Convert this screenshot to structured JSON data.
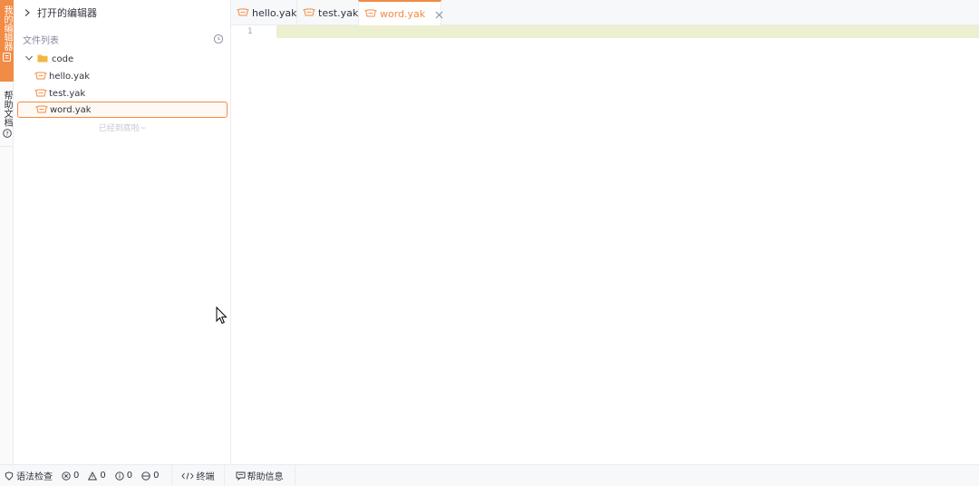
{
  "activity": {
    "active_label": "我的编辑器",
    "help_label": "帮助文档"
  },
  "panel": {
    "header_title": "打开的编辑器",
    "list_title": "文件列表",
    "folder": "code",
    "files": [
      "hello.yak",
      "test.yak",
      "word.yak"
    ],
    "end_text": "已经到底啦~"
  },
  "tabs": [
    {
      "label": "hello.yak"
    },
    {
      "label": "test.yak"
    },
    {
      "label": "word.yak"
    }
  ],
  "editor": {
    "line_number": "1"
  },
  "status": {
    "syntax_check": "语法检查",
    "errors": "0",
    "warnings": "0",
    "infos": "0",
    "hints": "0",
    "terminal": "终端",
    "help_info": "帮助信息"
  },
  "colors": {
    "accent": "#f28b44",
    "current_line": "#ecefd0"
  }
}
